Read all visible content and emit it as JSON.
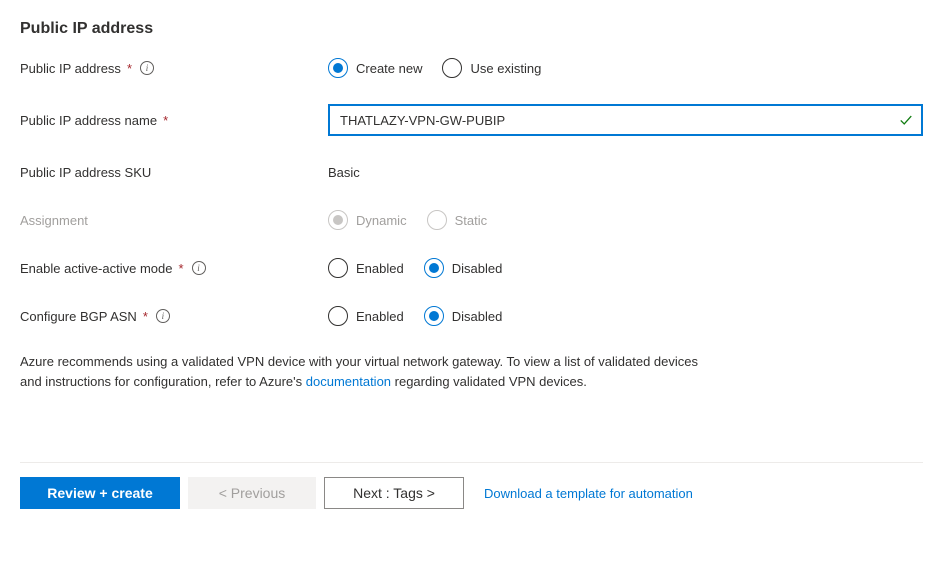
{
  "section": {
    "title": "Public IP address"
  },
  "fields": {
    "public_ip_address": {
      "label": "Public IP address",
      "required": true,
      "has_info": true,
      "options": {
        "create_new": "Create new",
        "use_existing": "Use existing"
      },
      "selected": "create_new"
    },
    "public_ip_address_name": {
      "label": "Public IP address name",
      "required": true,
      "has_info": false,
      "value": "THATLAZY-VPN-GW-PUBIP",
      "valid": true
    },
    "public_ip_address_sku": {
      "label": "Public IP address SKU",
      "required": false,
      "has_info": false,
      "value": "Basic"
    },
    "assignment": {
      "label": "Assignment",
      "required": false,
      "has_info": false,
      "disabled": true,
      "options": {
        "dynamic": "Dynamic",
        "static": "Static"
      },
      "selected": "dynamic"
    },
    "active_active": {
      "label": "Enable active-active mode",
      "required": true,
      "has_info": true,
      "options": {
        "enabled": "Enabled",
        "disabled": "Disabled"
      },
      "selected": "disabled"
    },
    "bgp_asn": {
      "label": "Configure BGP ASN",
      "required": true,
      "has_info": true,
      "options": {
        "enabled": "Enabled",
        "disabled": "Disabled"
      },
      "selected": "disabled"
    }
  },
  "advisory": {
    "pre": "Azure recommends using a validated VPN device with your virtual network gateway. To view a list of validated devices and instructions for configuration, refer to Azure's ",
    "link": "documentation",
    "post": " regarding validated VPN devices."
  },
  "footer": {
    "review_create": "Review + create",
    "previous": "< Previous",
    "next": "Next : Tags >",
    "download_link": "Download a template for automation"
  }
}
